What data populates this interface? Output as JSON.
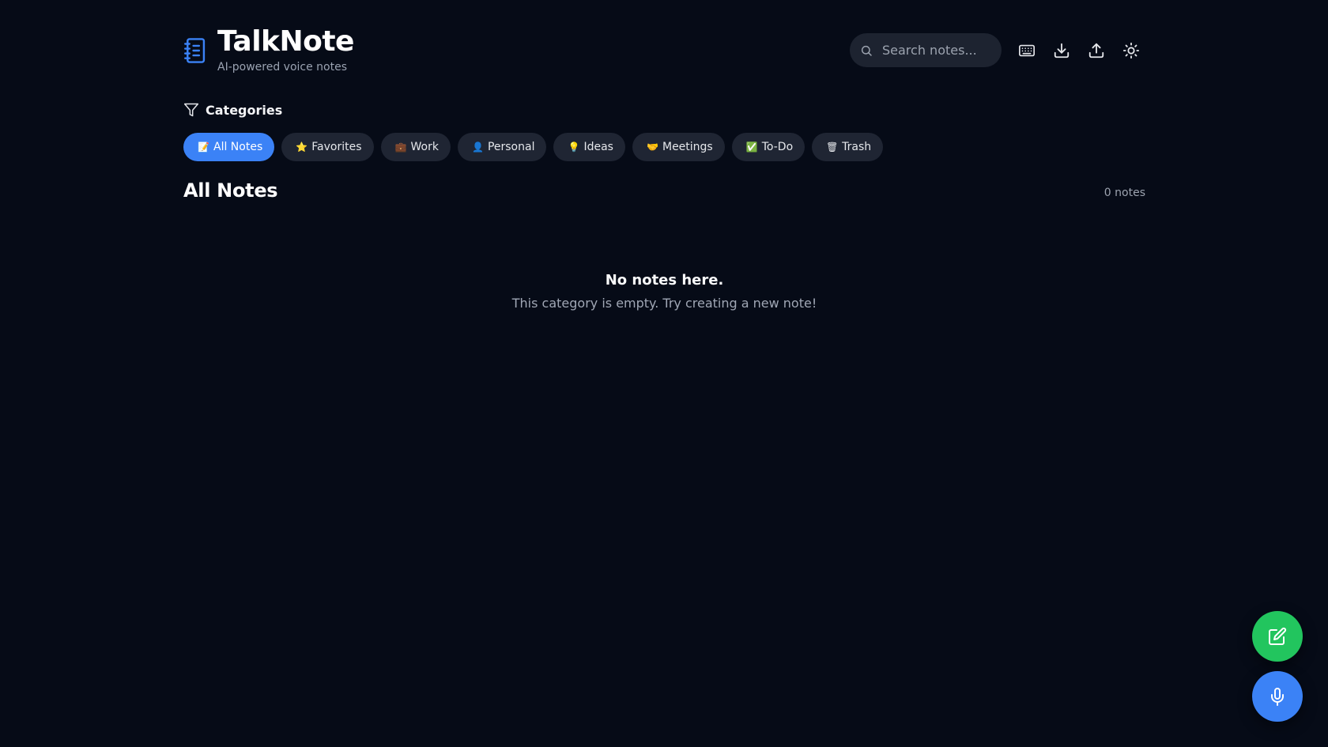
{
  "app": {
    "title": "TalkNote",
    "subtitle": "AI-powered voice notes",
    "logo_icon": "notebook-icon"
  },
  "search": {
    "placeholder": "Search notes...",
    "value": ""
  },
  "toolbar": {
    "buttons": [
      {
        "name": "keyboard-shortcuts",
        "icon": "keyboard-icon"
      },
      {
        "name": "download",
        "icon": "download-icon"
      },
      {
        "name": "upload",
        "icon": "upload-icon"
      },
      {
        "name": "theme-toggle",
        "icon": "sun-icon"
      }
    ]
  },
  "categories": {
    "heading": "Categories",
    "heading_icon": "filter-icon",
    "items": [
      {
        "label": "All Notes",
        "emoji": "📝",
        "active": true
      },
      {
        "label": "Favorites",
        "emoji": "⭐",
        "active": false
      },
      {
        "label": "Work",
        "emoji": "💼",
        "active": false
      },
      {
        "label": "Personal",
        "emoji": "👤",
        "active": false
      },
      {
        "label": "Ideas",
        "emoji": "💡",
        "active": false
      },
      {
        "label": "Meetings",
        "emoji": "🤝",
        "active": false
      },
      {
        "label": "To-Do",
        "emoji": "✅",
        "active": false
      },
      {
        "label": "Trash",
        "emoji": "🗑",
        "active": false
      }
    ]
  },
  "main": {
    "section_title": "All Notes",
    "note_count": "0 notes",
    "empty_title": "No notes here.",
    "empty_text": "This category is empty. Try creating a new note!"
  },
  "fabs": {
    "new_note_icon": "edit-icon",
    "record_icon": "microphone-icon"
  },
  "colors": {
    "background": "#060b17",
    "accent_blue": "#3b82f6",
    "accent_green": "#22c55e",
    "chip_bg": "#1f2533"
  }
}
